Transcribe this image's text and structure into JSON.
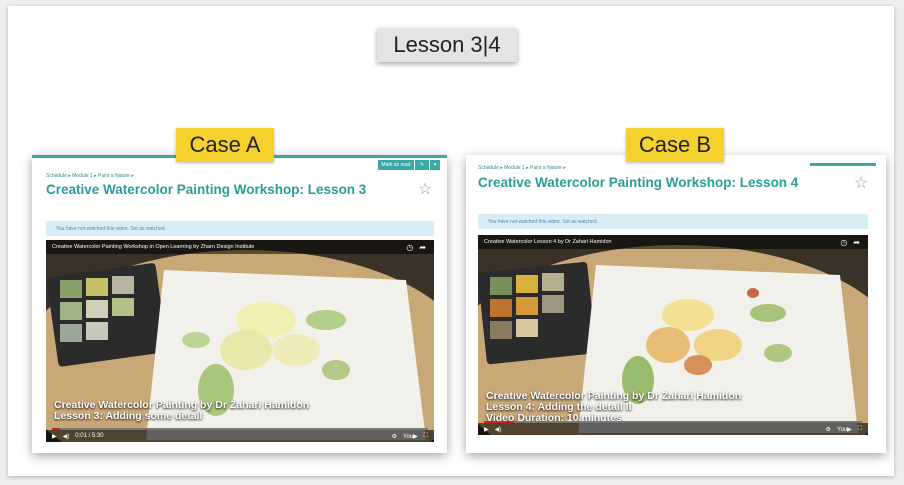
{
  "lesson_label": "Lesson 3|4",
  "cases": [
    {
      "label": "Case A",
      "breadcrumb": "Schedule ▸ Module 1 ▸ Paint a Nature ▸",
      "buttons": [
        "Mark as read",
        "✎",
        "▾"
      ],
      "title": "Creative Watercolor Painting Workshop: Lesson 3",
      "notice": "You have not watched this video. Set as watched.",
      "video": {
        "top_title": "Creative Watercolor Painting Workshop in Open Learning by Zharn Design Institute",
        "overlay_line1": "Creative Watercolor Painting by Dr Zahari Hamidon",
        "overlay_line2": "Lesson 3: Adding some detail",
        "overlay_line3": "",
        "time": "0:01 / 5:30",
        "progress": 0.02
      }
    },
    {
      "label": "Case B",
      "breadcrumb": "Schedule ▸ Module 1 ▸ Paint a Nature ▸",
      "buttons": [],
      "title": "Creative Watercolor Painting Workshop: Lesson 4",
      "notice": "You have not watched this video. Set as watched.",
      "video": {
        "top_title": "Creative Watercolor Lesson 4 by Dr Zahari Hamidon",
        "overlay_line1": "Creative Watercolor Painting by Dr Zahari Hamidon",
        "overlay_line2": "Lesson 4: Adding the detail II",
        "overlay_line3": "Video Duration: 10 minutes",
        "time": "",
        "progress": 0.08
      }
    }
  ],
  "icons": {
    "star": "☆",
    "clock": "◷",
    "share": "➦",
    "play": "▶",
    "volume": "◀)",
    "settings": "⚙",
    "youtube": "You▶",
    "fullscreen": "⛶"
  }
}
